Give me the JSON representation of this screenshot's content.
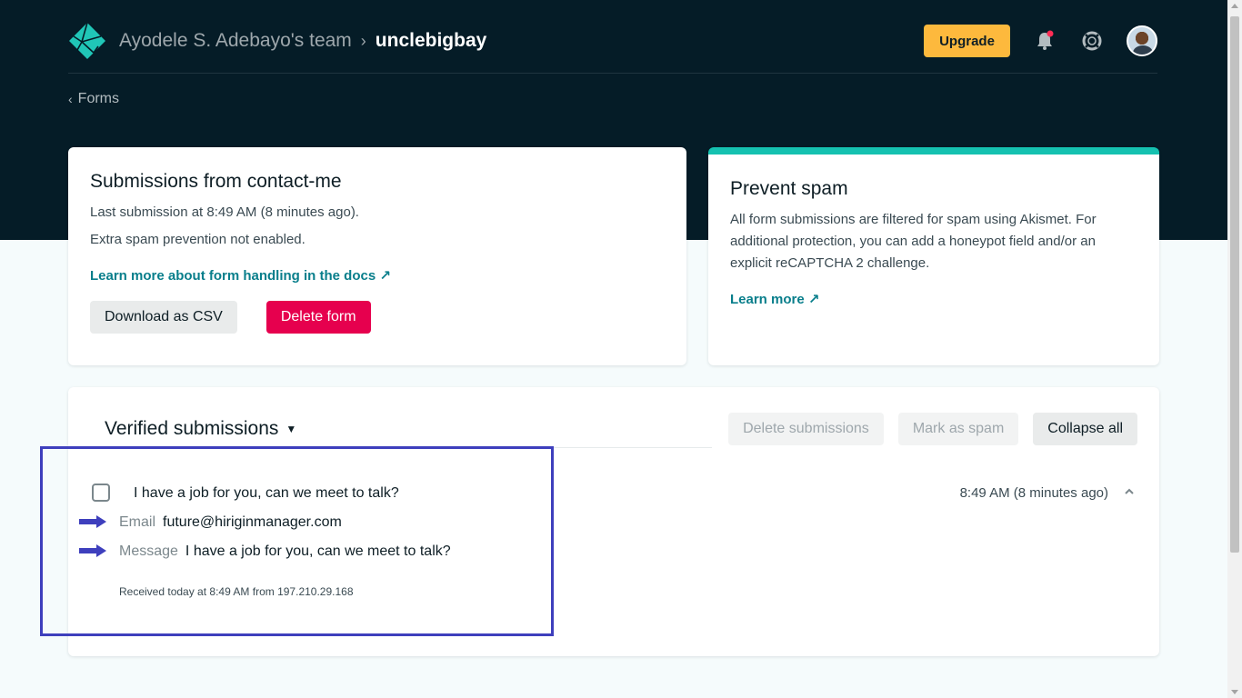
{
  "header": {
    "team_name": "Ayodele S. Adebayo's team",
    "breadcrumb_separator": "›",
    "site_name": "unclebigbay",
    "upgrade_label": "Upgrade"
  },
  "back_link": {
    "label": "Forms"
  },
  "form_card": {
    "title": "Submissions from contact-me",
    "last_submission": "Last submission at 8:49 AM (8 minutes ago).",
    "spam_status": "Extra spam prevention not enabled.",
    "docs_link": "Learn more about form handling in the docs ↗",
    "download_label": "Download as CSV",
    "delete_label": "Delete form"
  },
  "spam_card": {
    "title": "Prevent spam",
    "description": "All form submissions are filtered for spam using Akismet. For additional protection, you can add a honeypot field and/or an explicit reCAPTCHA 2 challenge.",
    "learn_more": "Learn more ↗",
    "accent_color": "#15c1b0"
  },
  "submissions": {
    "title": "Verified submissions",
    "actions": {
      "delete_label": "Delete submissions",
      "spam_label": "Mark as spam",
      "collapse_label": "Collapse all"
    },
    "items": [
      {
        "subject": "I have a job for you, can we meet to talk?",
        "time": "8:49 AM (8 minutes ago)",
        "fields": [
          {
            "label": "Email",
            "value": "future@hiriginmanager.com"
          },
          {
            "label": "Message",
            "value": "I have a job for you, can we meet to talk?"
          }
        ],
        "received": "Received today at 8:49 AM from 197.210.29.168"
      }
    ]
  },
  "colors": {
    "header_bg": "#051c27",
    "upgrade": "#fdb93d",
    "delete": "#e6004e",
    "link": "#087e8b",
    "annotation": "#3e3fbd"
  }
}
